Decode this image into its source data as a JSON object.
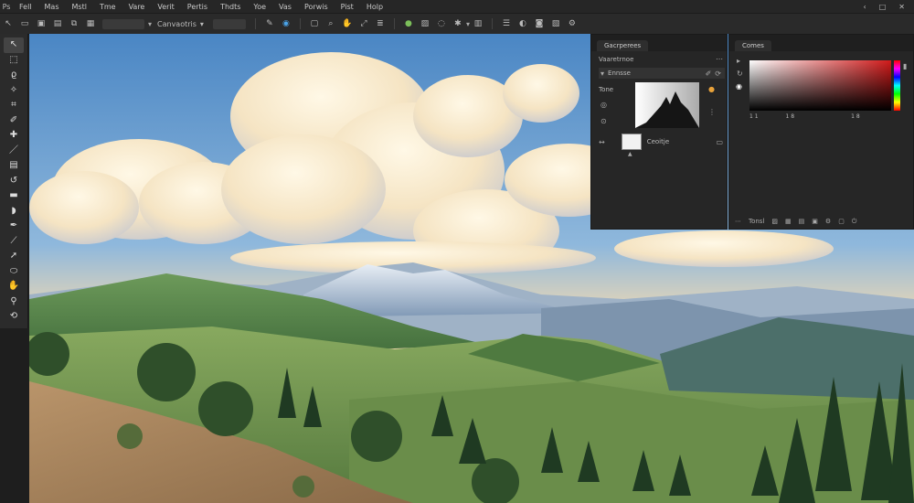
{
  "menu": {
    "app_icon": "Ps",
    "items": [
      "Fell",
      "Mas",
      "Mstl",
      "Tme",
      "Vare",
      "Verit",
      "Pertis",
      "Thdts",
      "Yoe",
      "Vas",
      "Porwis",
      "Pist",
      "Holp"
    ],
    "win_controls": [
      "‹",
      "□",
      "✕"
    ]
  },
  "options": {
    "dropdown_1": "Canvaotris"
  },
  "canvas": {
    "sky_top": "#4a86c4",
    "sky_bottom": "#f3d9a8"
  },
  "properties_panel": {
    "tab": "Gacrperees",
    "section": "Vaaretrnoe",
    "layer_name": "Ennsse",
    "tone_label": "Tone",
    "mask_label": "Ceoitje",
    "accent": "#e8a23a"
  },
  "color_panel": {
    "tab": "Comes",
    "ticks": [
      "1 1",
      "1 8",
      "1 8"
    ],
    "footer_label": "Tonsl"
  }
}
